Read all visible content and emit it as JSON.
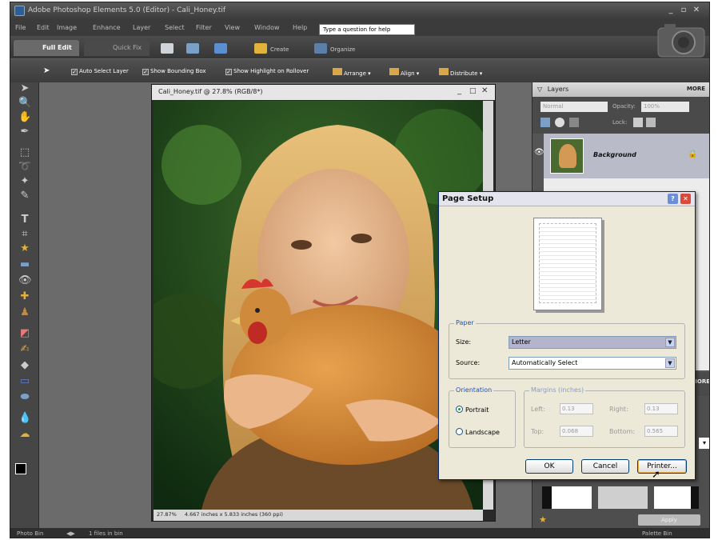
{
  "window": {
    "title": "Adobe Photoshop Elements 5.0 (Editor) - Cali_Honey.tif"
  },
  "menu": {
    "items": [
      "File",
      "Edit",
      "Image",
      "Enhance",
      "Layer",
      "Select",
      "Filter",
      "View",
      "Window",
      "Help"
    ],
    "help_placeholder": "Type a question for help"
  },
  "modes": {
    "full_edit": "Full Edit",
    "quick_fix": "Quick Fix"
  },
  "toolbar": {
    "create": "Create",
    "organize": "Organize"
  },
  "options": {
    "auto_select": "Auto Select Layer",
    "bounding": "Show Bounding Box",
    "highlight": "Show Highlight on Rollover",
    "arrange": "Arrange",
    "align": "Align",
    "distribute": "Distribute"
  },
  "document": {
    "title": "Cali_Honey.tif @ 27.8% (RGB/8*)",
    "zoom": "27.87%",
    "info": "4.667 inches x 5.833 inches (360 ppi)"
  },
  "layers": {
    "title": "Layers",
    "more": "MORE",
    "blend_mode": "Normal",
    "opacity_label": "Opacity:",
    "opacity": "100%",
    "lock_label": "Lock:",
    "layer_name": "Background"
  },
  "dialog": {
    "title": "Page Setup",
    "paper_group": "Paper",
    "size_label": "Size:",
    "size_value": "Letter",
    "source_label": "Source:",
    "source_value": "Automatically Select",
    "orientation_group": "Orientation",
    "portrait": "Portrait",
    "landscape": "Landscape",
    "margins_group": "Margins (inches)",
    "left_label": "Left:",
    "left_value": "0.13",
    "right_label": "Right:",
    "right_value": "0.13",
    "top_label": "Top:",
    "top_value": "0.068",
    "bottom_label": "Bottom:",
    "bottom_value": "0.565",
    "ok": "OK",
    "cancel": "Cancel",
    "printer": "Printer..."
  },
  "panel": {
    "apply": "Apply",
    "more2": "MORE"
  },
  "status": {
    "photo_bin": "Photo Bin",
    "files": "1 files in bin",
    "palette_bin": "Palette Bin"
  },
  "colors": {
    "accent": "#2f5e96",
    "dialog_bg": "#ece9d8",
    "app_bg": "#3d3d3d"
  }
}
